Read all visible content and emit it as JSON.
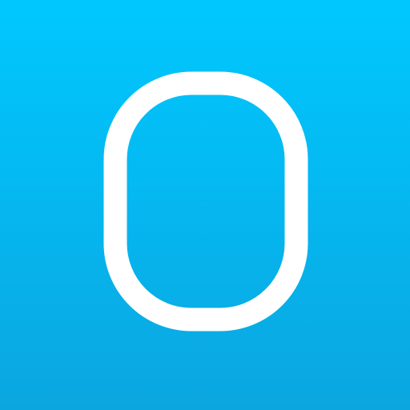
{
  "icon": {
    "glyph_name": "rounded-rectangle-outline-icon",
    "colors": {
      "background_top": "#00c8ff",
      "background_bottom": "#0ba6e0",
      "glyph": "#ffffff"
    }
  }
}
